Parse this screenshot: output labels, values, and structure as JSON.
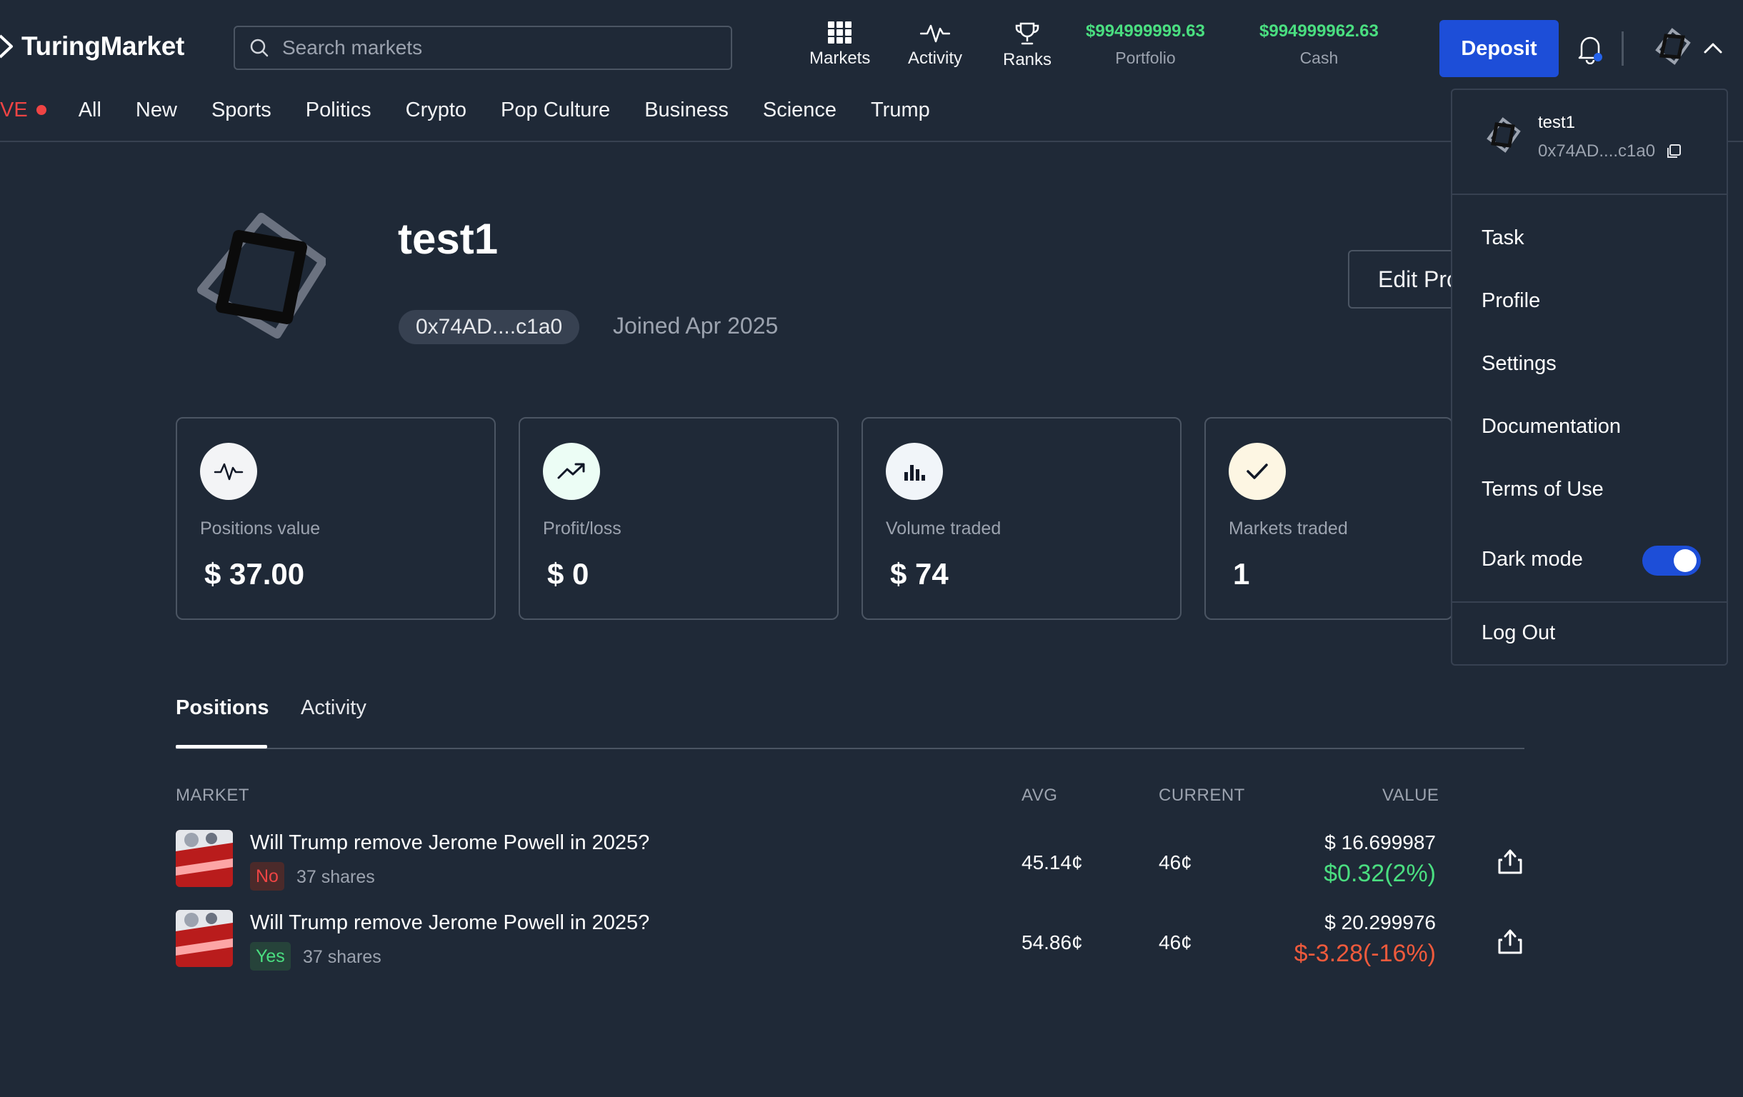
{
  "header": {
    "brand": "TuringMarket",
    "search_placeholder": "Search markets",
    "nav": [
      {
        "label": "Markets",
        "icon": "grid-icon"
      },
      {
        "label": "Activity",
        "icon": "pulse-icon"
      },
      {
        "label": "Ranks",
        "icon": "trophy-icon"
      }
    ],
    "portfolio": {
      "amount": "$994999999.63",
      "label": "Portfolio"
    },
    "cash": {
      "amount": "$994999962.63",
      "label": "Cash"
    },
    "deposit_label": "Deposit"
  },
  "categories": {
    "live_label": "VE",
    "items": [
      "All",
      "New",
      "Sports",
      "Politics",
      "Crypto",
      "Pop Culture",
      "Business",
      "Science",
      "Trump"
    ]
  },
  "profile": {
    "username": "test1",
    "address": "0x74AD....c1a0",
    "joined": "Joined Apr 2025",
    "edit_label": "Edit Profile"
  },
  "stats": [
    {
      "label": "Positions value",
      "value": "$ 37.00",
      "icon": "pulse-icon"
    },
    {
      "label": "Profit/loss",
      "value": "$ 0",
      "icon": "trending-up-icon"
    },
    {
      "label": "Volume traded",
      "value": "$ 74",
      "icon": "bar-chart-icon"
    },
    {
      "label": "Markets traded",
      "value": "1",
      "icon": "check-icon"
    }
  ],
  "tabs": {
    "active": "Positions",
    "inactive": "Activity"
  },
  "table": {
    "headers": {
      "market": "MARKET",
      "avg": "AVG",
      "current": "CURRENT",
      "value": "VALUE"
    },
    "rows": [
      {
        "title": "Will Trump remove Jerome Powell in 2025?",
        "outcome": "No",
        "shares": "37 shares",
        "avg": "45.14¢",
        "current": "46¢",
        "value": "$ 16.699987",
        "change": "$0.32(2%)"
      },
      {
        "title": "Will Trump remove Jerome Powell in 2025?",
        "outcome": "Yes",
        "shares": "37 shares",
        "avg": "54.86¢",
        "current": "46¢",
        "value": "$ 20.299976",
        "change": "$-3.28(-16%)"
      }
    ]
  },
  "menu": {
    "username": "test1",
    "address": "0x74AD....c1a0",
    "items": [
      "Task",
      "Profile",
      "Settings",
      "Documentation",
      "Terms of Use"
    ],
    "dark_mode_label": "Dark mode",
    "dark_mode_on": true,
    "logout_label": "Log Out"
  },
  "colors": {
    "background": "#1f2937",
    "accent": "#1d4ed8",
    "positive": "#4ade80",
    "negative": "#ef5a3c",
    "live": "#ef4444"
  }
}
